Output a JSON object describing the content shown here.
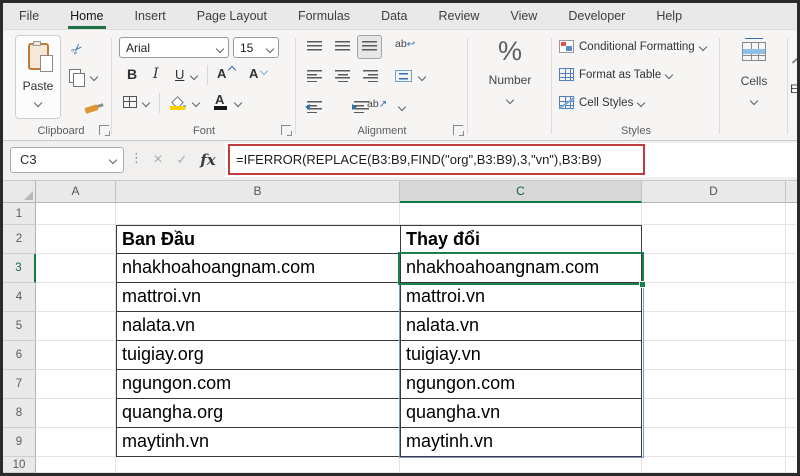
{
  "menu": {
    "tabs": [
      "File",
      "Home",
      "Insert",
      "Page Layout",
      "Formulas",
      "Data",
      "Review",
      "View",
      "Developer",
      "Help"
    ],
    "active_tab": "Home"
  },
  "ribbon": {
    "clipboard": {
      "group_label": "Clipboard",
      "paste_label": "Paste"
    },
    "font": {
      "group_label": "Font",
      "font_name": "Arial",
      "font_size": "15",
      "bold_label": "B",
      "italic_label": "I",
      "underline_label": "U",
      "grow_font_label": "A",
      "shrink_font_label": "A",
      "font_color_label": "A"
    },
    "alignment": {
      "group_label": "Alignment",
      "ab_label": "ab"
    },
    "number": {
      "label": "Number",
      "percent_glyph": "%"
    },
    "styles": {
      "group_label": "Styles",
      "conditional_formatting": "Conditional Formatting",
      "format_as_table": "Format as Table",
      "cell_styles": "Cell Styles"
    },
    "cells": {
      "label": "Cells"
    },
    "editing": {
      "label_clipped": "Ed"
    }
  },
  "formula_bar": {
    "name_box_value": "C3",
    "more_glyph": "⋮",
    "cancel_glyph": "×",
    "enter_glyph": "✓",
    "fx_label": "fx",
    "formula": "=IFERROR(REPLACE(B3:B9,FIND(\"org\",B3:B9),3,\"vn\"),B3:B9)"
  },
  "icons": {
    "scissors_glyph": "✂",
    "wrap_arrow_glyph": "↩",
    "orientation_arrow_glyph": "↗"
  },
  "grid": {
    "column_letters": [
      "A",
      "B",
      "C",
      "D"
    ],
    "row_numbers": [
      "1",
      "2",
      "3",
      "4",
      "5",
      "6",
      "7",
      "8",
      "9",
      "10"
    ],
    "active_cell": "C3",
    "selected_column": "C",
    "selected_row": "3",
    "table": {
      "header_original": "Ban Đầu",
      "header_changed": "Thay đổi",
      "rows": [
        {
          "original": "nhakhoahoangnam.com",
          "changed": "nhakhoahoangnam.com"
        },
        {
          "original": "mattroi.vn",
          "changed": "mattroi.vn"
        },
        {
          "original": "nalata.vn",
          "changed": "nalata.vn"
        },
        {
          "original": "tuigiay.org",
          "changed": "tuigiay.vn"
        },
        {
          "original": "ngungon.com",
          "changed": "ngungon.com"
        },
        {
          "original": "quangha.org",
          "changed": "quangha.vn"
        },
        {
          "original": "maytinh.vn",
          "changed": "maytinh.vn"
        }
      ]
    }
  },
  "colors": {
    "accent_green": "#107C41",
    "formula_outline_red": "#C23B3B",
    "spill_border_blue": "#7A9CC6",
    "fill_highlight_yellow": "#FFD100"
  }
}
